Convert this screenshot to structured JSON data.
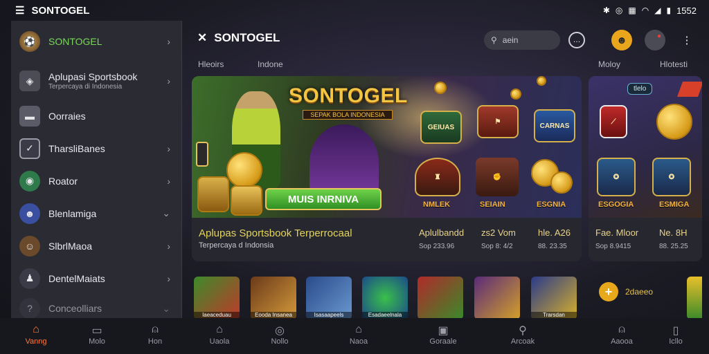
{
  "statusbar": {
    "app_name": "SONTOGEL",
    "time": "1552"
  },
  "sidebar": {
    "items": [
      {
        "label": "SONTOGEL",
        "sub": "",
        "active": true
      },
      {
        "label": "Aplupasi Sportsbook",
        "sub": "Terpercaya di Indonesia"
      },
      {
        "label": "Oorraies",
        "sub": ""
      },
      {
        "label": "TharsliBanes",
        "sub": ""
      },
      {
        "label": "Roator",
        "sub": ""
      },
      {
        "label": "Blenlamiga",
        "sub": ""
      },
      {
        "label": "SlbrlMaoa",
        "sub": ""
      },
      {
        "label": "DentelMaiats",
        "sub": ""
      },
      {
        "label": "Conceolliars",
        "sub": ""
      }
    ]
  },
  "header": {
    "title": "SONTOGEL",
    "search_placeholder": "aein",
    "tabs": [
      "Hleoirs",
      "Indone",
      "Moloy",
      "Hlotesti"
    ]
  },
  "banner": {
    "logo": "SONTOGEL",
    "logo_tag": "SEPAK BOLA INDONESIA",
    "cta": "MUIS INRNIVA",
    "tiles": [
      {
        "name": "GEIUAS",
        "label": "NMLEK"
      },
      {
        "name": "",
        "label": "SEIAIN"
      },
      {
        "name": "CARNAS",
        "label": "ESGNIA"
      }
    ],
    "info_title": "Aplupas Sportsbook Terperrocaal",
    "info_sub": "Terpercaya d Indonsia",
    "info_cells": [
      {
        "title": "Aplulbandd",
        "sub": "Sop 233.96"
      },
      {
        "title": "zs2 Vom",
        "sub": "Sop 8: 4/2"
      },
      {
        "title": "hle. A26",
        "sub": "88. 23.35"
      }
    ]
  },
  "banner_side": {
    "badge": "tlelo",
    "tiles": [
      {
        "label": "ESGOGIA"
      },
      {
        "label": "ESMIGA"
      }
    ],
    "info_cells": [
      {
        "title": "Fae. Mloor",
        "sub": "Sop 8.9415"
      },
      {
        "title": "Ne. 8H",
        "sub": "88. 25.25"
      }
    ]
  },
  "games": [
    {
      "name": "Iaeaceduau",
      "color": "#3d8a2a"
    },
    {
      "name": "Eooda Insanea",
      "color": "#6b3a1a"
    },
    {
      "name": "Isasaapeels",
      "color": "#2a4a8a"
    },
    {
      "name": "Esadaeelnala",
      "color": "#2a6a3a"
    },
    {
      "name": "",
      "color": "#8a2a2a"
    },
    {
      "name": "",
      "color": "#5a2a7a"
    },
    {
      "name": "Trarsdan",
      "color": "#2a3a7a"
    }
  ],
  "games_promo": "2daeeo",
  "bottom_nav": [
    {
      "label": "Vanng",
      "icon": "home-icon",
      "active": true
    },
    {
      "label": "Molo",
      "icon": "square-icon"
    },
    {
      "label": "Hon",
      "icon": "user-icon"
    },
    {
      "label": "Uaola",
      "icon": "home-icon"
    },
    {
      "label": "Nollo",
      "icon": "circle-icon"
    },
    {
      "label": "Naoa",
      "icon": "home-icon"
    },
    {
      "label": "Goraale",
      "icon": "chat-icon"
    },
    {
      "label": "Arcoak",
      "icon": "search-icon"
    },
    {
      "label": "Aaooa",
      "icon": "user-icon"
    },
    {
      "label": "Icllo",
      "icon": "square-icon"
    }
  ]
}
